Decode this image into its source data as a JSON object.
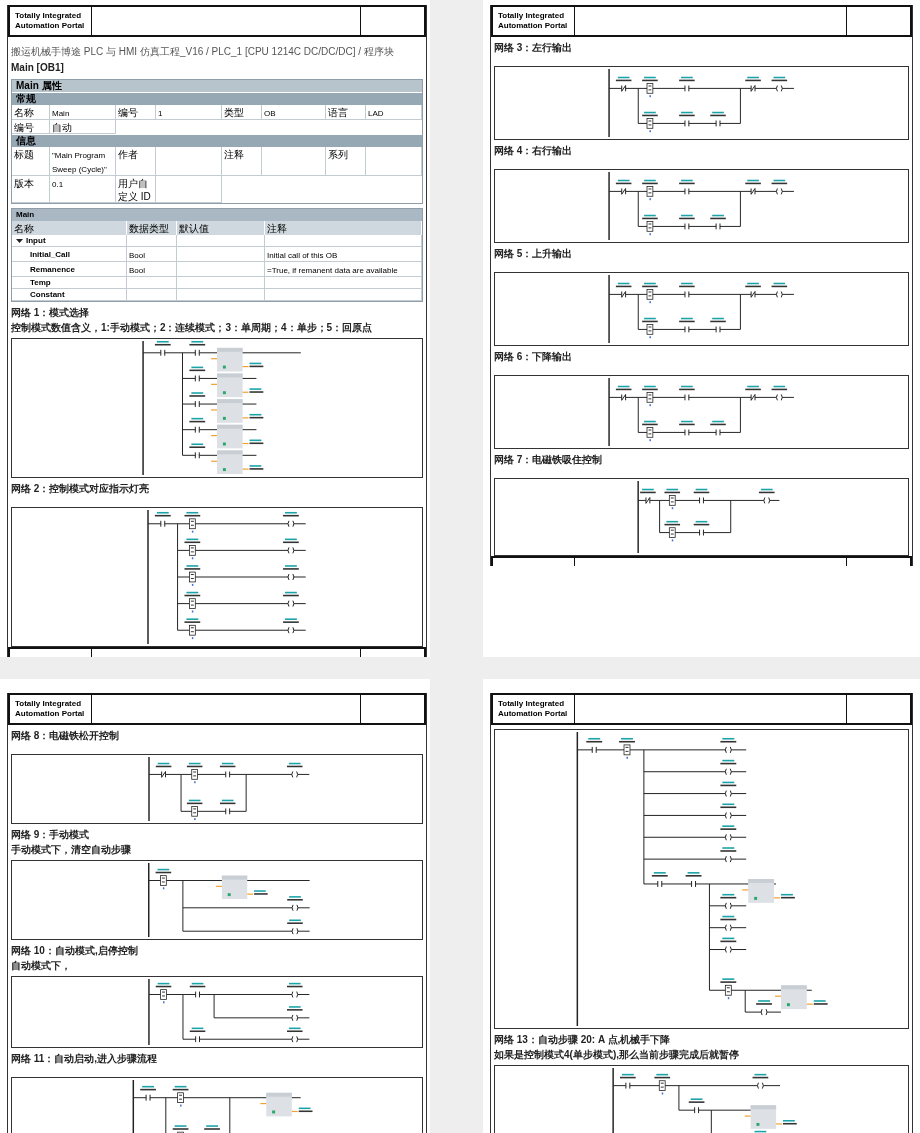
{
  "pages": [
    {
      "header": {
        "logo": "Totally Integrated\nAutomation Portal"
      },
      "footer": true,
      "title": "搬运机械手博途 PLC 与 HMI 仿真工程_V16 / PLC_1 [CPU 1214C DC/DC/DC] / 程序块",
      "block": "Main [OB1]",
      "properties": {
        "title": "Main 属性",
        "sections": [
          {
            "title": "常规",
            "rows": [
              [
                {
                  "label": "名称",
                  "value": "Main"
                },
                {
                  "label": "编号",
                  "value": "1"
                },
                {
                  "label": "类型",
                  "value": "OB"
                },
                {
                  "label": "语言",
                  "value": "LAD"
                }
              ],
              [
                {
                  "label": "编号",
                  "value": "自动"
                }
              ]
            ]
          },
          {
            "title": "信息",
            "rows": [
              [
                {
                  "label": "标题",
                  "value": "\"Main Program Sweep (Cycle)\""
                },
                {
                  "label": "作者"
                },
                {
                  "label": "注释"
                },
                {
                  "label": "系列"
                }
              ],
              [
                {
                  "label": "版本",
                  "value": "0.1"
                },
                {
                  "label": "用户自定义 ID"
                }
              ]
            ]
          }
        ]
      },
      "interface": {
        "title": "Main",
        "columns": [
          "名称",
          "数据类型",
          "默认值",
          "注释"
        ],
        "rows": [
          {
            "name": "Input",
            "expanded": true,
            "children": [
              {
                "name": "Initial_Call",
                "type": "Bool",
                "comment": "Initial call of this OB"
              },
              {
                "name": "Remanence",
                "type": "Bool",
                "comment": "=True, if remanent data are available"
              }
            ]
          },
          {
            "name": "Temp"
          },
          {
            "name": "Constant"
          }
        ]
      },
      "networks": [
        {
          "title": "网络 1：模式选择",
          "comment": "控制模式数值含义，1:手动模式；2：连续模式；3：单周期；4：单步；5：回原点",
          "kind": "move-branches"
        },
        {
          "title": "网络 2：控制模式对应指示灯亮",
          "kind": "coil-branches"
        }
      ]
    },
    {
      "header": {
        "logo": "Totally Integrated\nAutomation Portal"
      },
      "footer": true,
      "networks": [
        {
          "title": "网络 3：左行输出",
          "kind": "interlock"
        },
        {
          "title": "网络 4：右行输出",
          "kind": "interlock"
        },
        {
          "title": "网络 5：上升输出",
          "kind": "interlock"
        },
        {
          "title": "网络 6：下降输出",
          "kind": "interlock"
        },
        {
          "title": "网络 7：电磁铁吸住控制",
          "kind": "latch"
        }
      ]
    },
    {
      "header": {
        "logo": "Totally Integrated\nAutomation Portal"
      },
      "networks": [
        {
          "title": "网络 8：电磁铁松开控制",
          "kind": "latch-wide"
        },
        {
          "title": "网络 9：手动模式",
          "comment": "手动模式下，清空自动步骤",
          "kind": "manual"
        },
        {
          "title": "网络 10：自动模式,启停控制",
          "comment": "自动模式下，",
          "kind": "auto-run"
        },
        {
          "title": "网络 11：自动启动,进入步骤流程",
          "kind": "step-start"
        }
      ]
    },
    {
      "header": {
        "logo": "Totally Integrated\nAutomation Portal"
      },
      "networks": [
        {
          "kind": "step-long"
        },
        {
          "title": "网络 13：自动步骤 20: A 点,机械手下降",
          "comment": "如果是控制模式4(单步模式),那么当前步骤完成后就暂停",
          "kind": "step-20"
        }
      ]
    }
  ]
}
